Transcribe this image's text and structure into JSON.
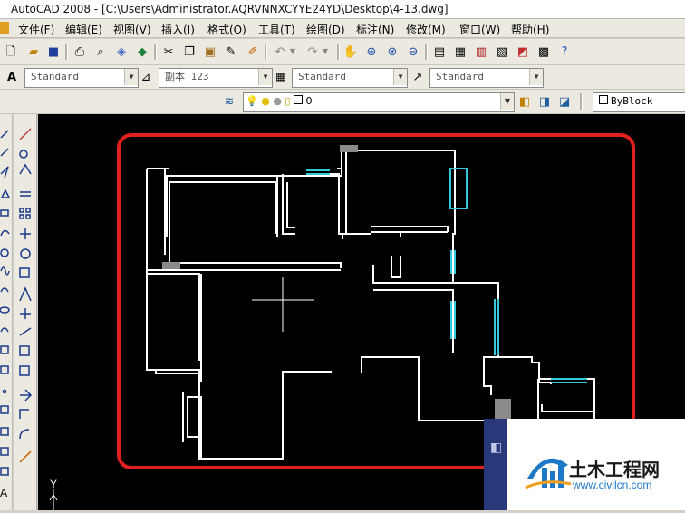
{
  "window": {
    "title": "AutoCAD 2008 - [C:\\Users\\Administrator.AQRVNNXCYYE24YD\\Desktop\\4-13.dwg]"
  },
  "menu": [
    "文件(F)",
    "编辑(E)",
    "视图(V)",
    "插入(I)",
    "格式(O)",
    "工具(T)",
    "绘图(D)",
    "标注(N)",
    "修改(M)",
    "窗口(W)",
    "帮助(H)"
  ],
  "styles_toolbar": {
    "text_style": "Standard",
    "dim_style": "副本 123",
    "table_style": "Standard",
    "multileader_style": "Standard"
  },
  "layers_toolbar": {
    "current_layer": "0"
  },
  "properties_toolbar": {
    "color": "ByBlock"
  },
  "ucs": {
    "y_label": "Y"
  },
  "watermark": {
    "name": "土木工程网",
    "url": "www.civilcn.com"
  },
  "colors": {
    "canvas": "#000000",
    "highlight": "#e02020",
    "walls": "#ffffff",
    "windows": "#33c8d8"
  },
  "icons": [
    "new-icon",
    "open-icon",
    "save-icon",
    "print-icon",
    "preview-icon",
    "publish-icon",
    "plot-icon",
    "cut-icon",
    "copy-icon",
    "paste-icon",
    "match-properties-icon",
    "block-editor-icon",
    "undo-icon",
    "redo-icon",
    "pan-icon",
    "zoom-realtime-icon",
    "zoom-window-icon",
    "zoom-previous-icon",
    "properties-icon",
    "design-center-icon",
    "tool-palettes-icon",
    "sheet-set-icon",
    "markup-icon",
    "calculator-icon",
    "help-icon"
  ]
}
